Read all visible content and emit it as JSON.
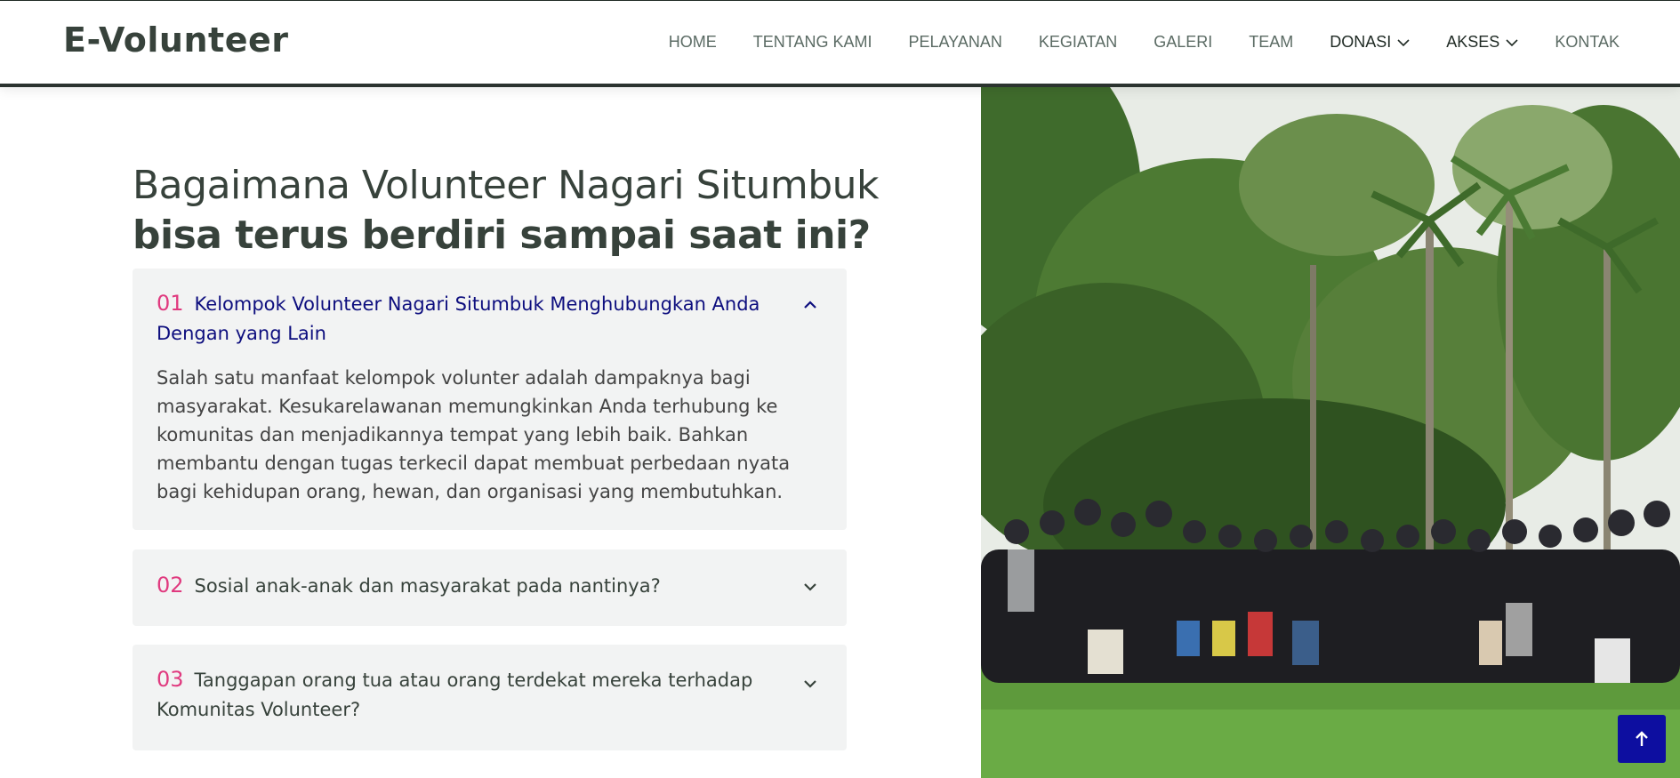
{
  "header": {
    "logo": "E-Volunteer",
    "nav": [
      {
        "label": "HOME"
      },
      {
        "label": "TENTANG KAMI"
      },
      {
        "label": "PELAYANAN"
      },
      {
        "label": "KEGIATAN"
      },
      {
        "label": "GALERI"
      },
      {
        "label": "TEAM"
      },
      {
        "label": "DONASI",
        "dropdown": true
      },
      {
        "label": "AKSES",
        "dropdown": true
      },
      {
        "label": "KONTAK"
      }
    ]
  },
  "section": {
    "title_line1": "Bagaimana Volunteer Nagari Situmbuk",
    "title_line2": "bisa terus berdiri sampai saat ini?",
    "faqs": [
      {
        "number": "01",
        "question": "Kelompok Volunteer Nagari Situmbuk Menghubungkan Anda Dengan yang Lain",
        "answer": "Salah satu manfaat kelompok volunter adalah dampaknya bagi masyarakat. Kesukarelawanan memungkinkan Anda terhubung ke komunitas dan menjadikannya tempat yang lebih baik. Bahkan membantu dengan tugas terkecil dapat membuat perbedaan nyata bagi kehidupan orang, hewan, dan organisasi yang membutuhkan.",
        "expanded": true
      },
      {
        "number": "02",
        "question": "Sosial anak-anak dan masyarakat pada nantinya?",
        "expanded": false
      },
      {
        "number": "03",
        "question": "Tanggapan orang tua atau orang terdekat mereka terhadap Komunitas Volunteer?",
        "expanded": false
      }
    ]
  },
  "colors": {
    "accent_number": "#e03a7f",
    "active_question": "#0d0e7e",
    "scroll_button": "#0d0ea0"
  },
  "icons": {
    "dropdown": "chevron-down-icon",
    "collapse": "chevron-up-icon",
    "expand": "chevron-down-icon",
    "scroll_top": "arrow-up-icon"
  }
}
